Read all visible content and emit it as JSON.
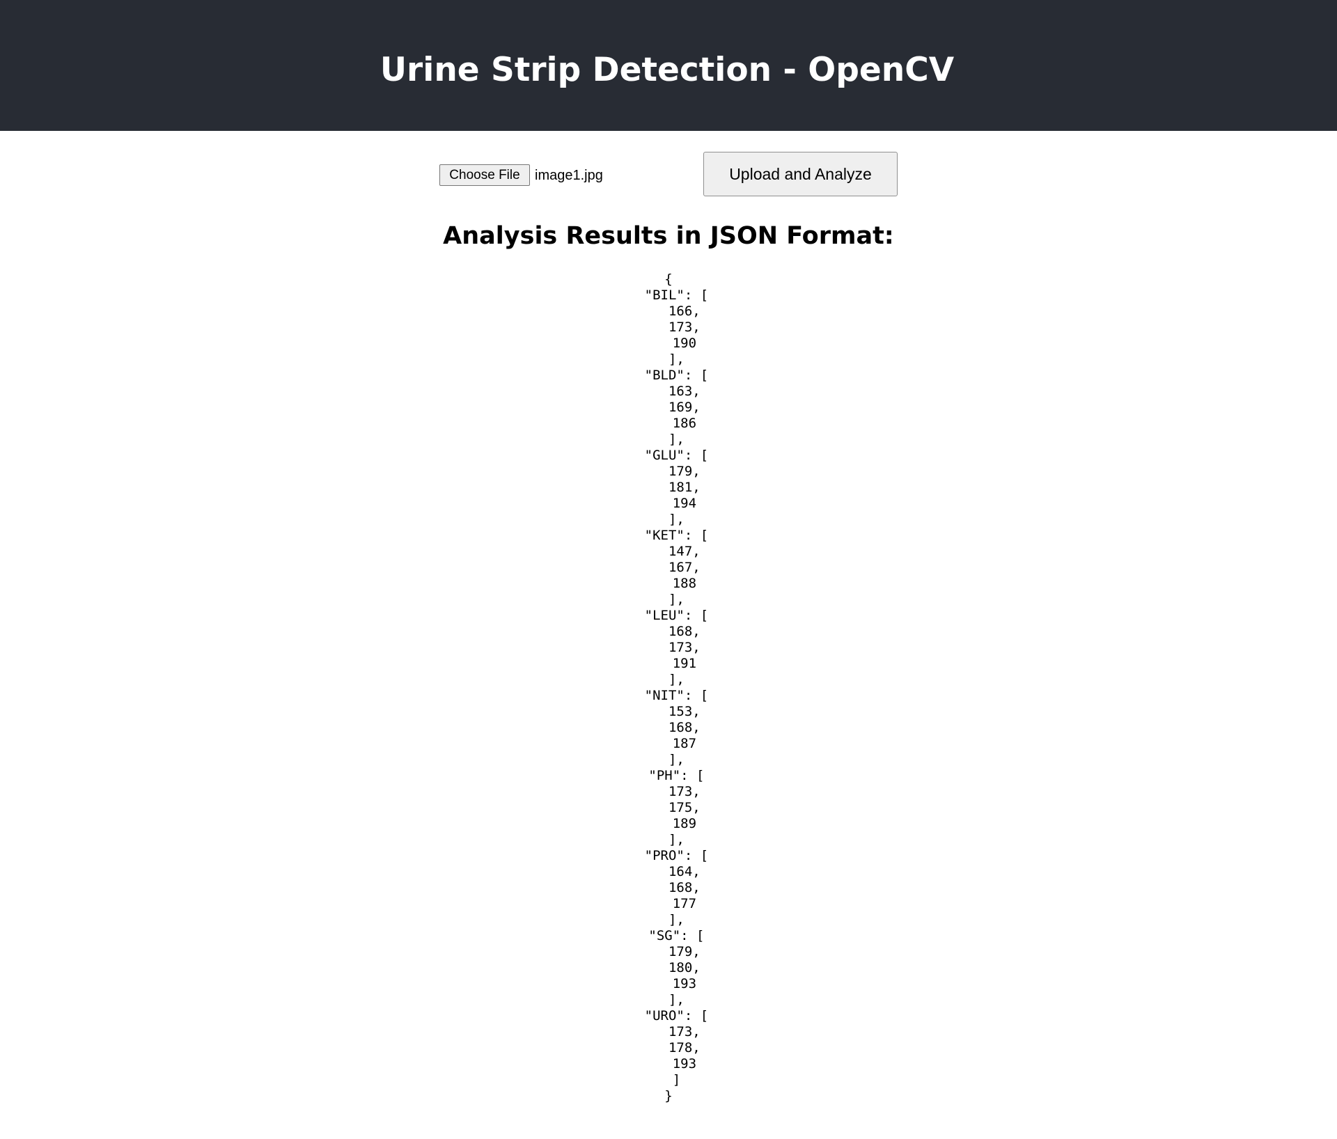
{
  "header": {
    "title": "Urine Strip Detection - OpenCV"
  },
  "upload": {
    "choose_file_label": "Choose File",
    "file_name": "image1.jpg",
    "submit_label": "Upload and Analyze"
  },
  "results": {
    "heading": "Analysis Results in JSON Format:",
    "json_text": "{\n  \"BIL\": [\n    166,\n    173,\n    190\n  ],\n  \"BLD\": [\n    163,\n    169,\n    186\n  ],\n  \"GLU\": [\n    179,\n    181,\n    194\n  ],\n  \"KET\": [\n    147,\n    167,\n    188\n  ],\n  \"LEU\": [\n    168,\n    173,\n    191\n  ],\n  \"NIT\": [\n    153,\n    168,\n    187\n  ],\n  \"PH\": [\n    173,\n    175,\n    189\n  ],\n  \"PRO\": [\n    164,\n    168,\n    177\n  ],\n  \"SG\": [\n    179,\n    180,\n    193\n  ],\n  \"URO\": [\n    173,\n    178,\n    193\n  ]\n}",
    "values": {
      "BIL": [
        166,
        173,
        190
      ],
      "BLD": [
        163,
        169,
        186
      ],
      "GLU": [
        179,
        181,
        194
      ],
      "KET": [
        147,
        167,
        188
      ],
      "LEU": [
        168,
        173,
        191
      ],
      "NIT": [
        153,
        168,
        187
      ],
      "PH": [
        173,
        175,
        189
      ],
      "PRO": [
        164,
        168,
        177
      ],
      "SG": [
        179,
        180,
        193
      ],
      "URO": [
        173,
        178,
        193
      ]
    }
  },
  "colors": {
    "header_bg": "#282c34",
    "header_text": "#ffffff",
    "button_bg": "#efefef"
  }
}
